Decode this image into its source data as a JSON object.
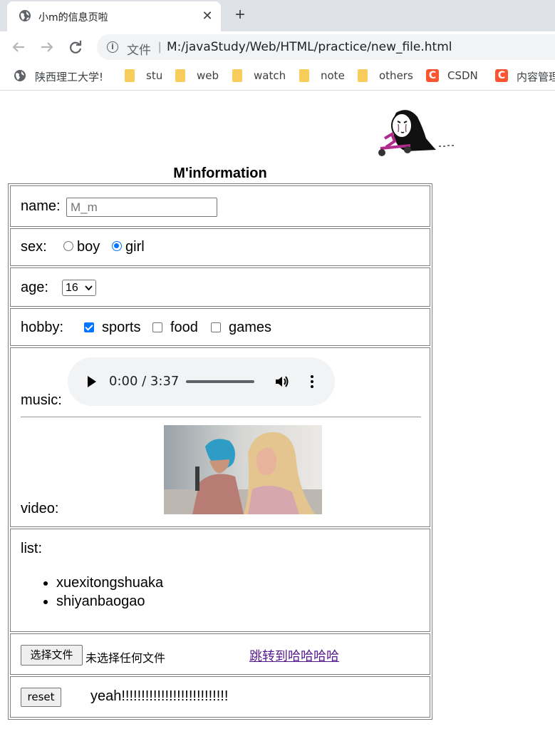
{
  "browser": {
    "tab_title": "小m的信息页啦",
    "close_glyph": "✕",
    "new_tab_glyph": "+",
    "file_label": "文件",
    "separator": "|",
    "url": "M:/javaStudy/Web/HTML/practice/new_file.html",
    "bookmarks": [
      {
        "label": "陕西理工大学!",
        "icon": "globe-icon"
      },
      {
        "label": "stu",
        "icon": "folder-icon"
      },
      {
        "label": "web",
        "icon": "folder-icon"
      },
      {
        "label": "watch",
        "icon": "folder-icon"
      },
      {
        "label": "note",
        "icon": "folder-icon"
      },
      {
        "label": "others",
        "icon": "folder-icon"
      },
      {
        "label": "CSDN",
        "icon": "csdn-icon"
      },
      {
        "label": "内容管理",
        "icon": "csdn-icon"
      }
    ]
  },
  "page": {
    "caption": "M'information",
    "name_label": "name:",
    "name_value": "M_m",
    "sex_label": "sex:",
    "sex_options": [
      "boy",
      "girl"
    ],
    "sex_selected": "girl",
    "age_label": "age:",
    "age_value": "16",
    "hobby_label": "hobby:",
    "hobbies": [
      {
        "label": "sports",
        "checked": true
      },
      {
        "label": "food",
        "checked": false
      },
      {
        "label": "games",
        "checked": false
      }
    ],
    "music_label": "music:",
    "audio_time": "0:00 / 3:37",
    "video_label": "video:",
    "list_label": "list:",
    "list_items": [
      "xuexitongshuaka",
      "shiyanbaogao"
    ],
    "file_button": "选择文件",
    "no_file_text": "未选择任何文件",
    "link_text": "跳转到哈哈哈哈",
    "reset_button": "reset",
    "yeah_text": "yeah!!!!!!!!!!!!!!!!!!!!!!!!!!!"
  },
  "colors": {
    "accent": "#0075ff",
    "visited_link": "#551a8b",
    "tabstrip": "#dee1e6"
  }
}
